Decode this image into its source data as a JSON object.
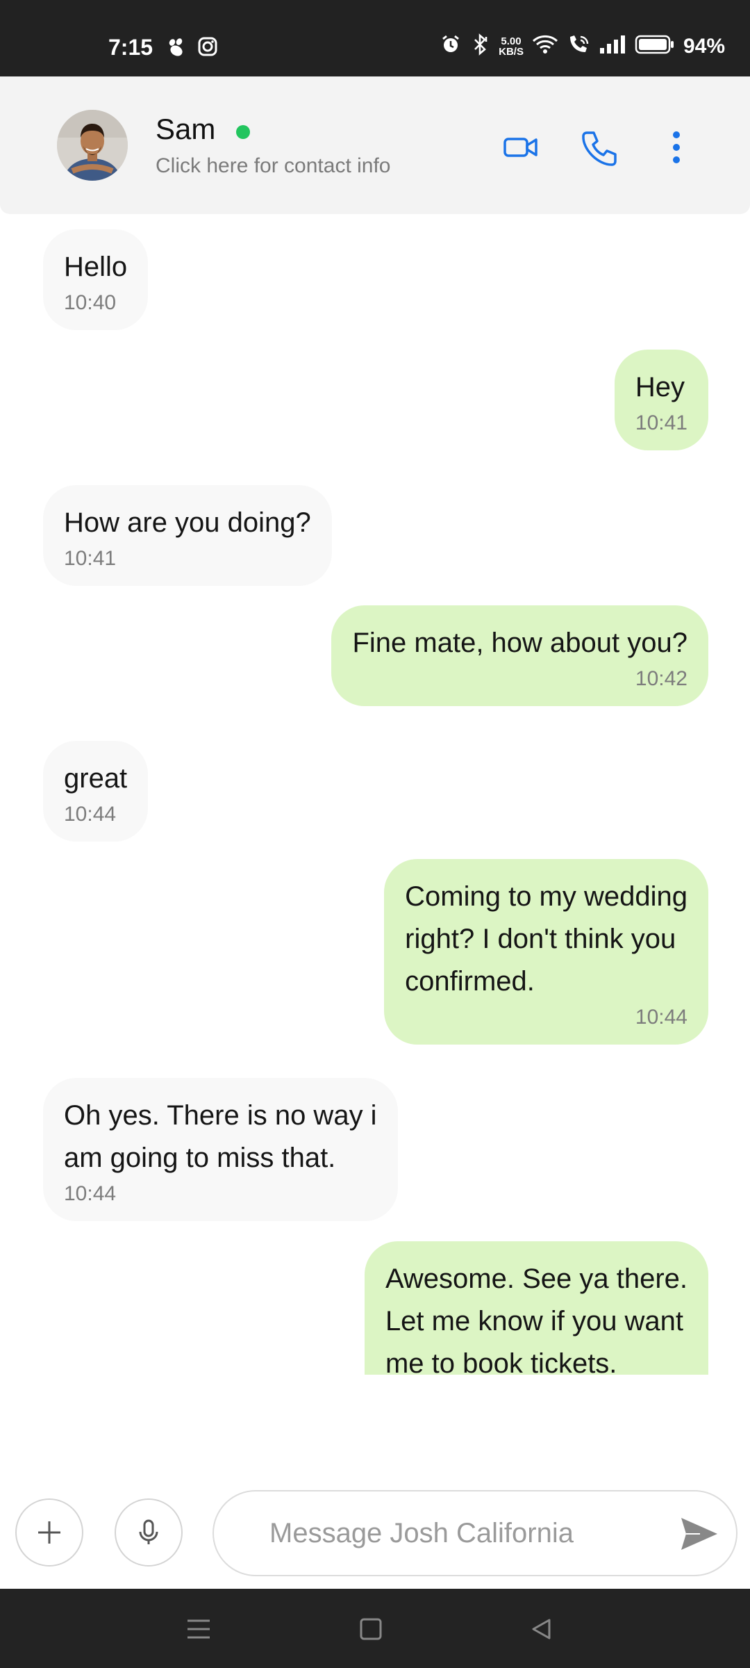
{
  "status_bar": {
    "time": "7:15",
    "speed_top": "5.00",
    "speed_bottom": "KB/S",
    "battery": "94%",
    "left_icons": [
      "paw-app-icon",
      "instagram-icon"
    ],
    "right_icons": [
      "alarm-icon",
      "bluetooth-icon",
      "wifi-icon",
      "wifi-call-icon",
      "signal-icon",
      "battery-icon"
    ]
  },
  "header": {
    "name": "Sam",
    "subtitle": "Click here for contact info",
    "online_color": "#22c55e",
    "accent_color": "#1a73e8"
  },
  "messages": [
    {
      "dir": "in",
      "lines": [
        "Hello"
      ],
      "time": "10:40"
    },
    {
      "dir": "out",
      "lines": [
        "Hey"
      ],
      "time": "10:41"
    },
    {
      "dir": "in",
      "lines": [
        "How are you doing?"
      ],
      "time": "10:41"
    },
    {
      "dir": "out",
      "lines": [
        "Fine mate, how about you?"
      ],
      "time": "10:42"
    },
    {
      "dir": "in",
      "lines": [
        "great"
      ],
      "time": "10:44"
    },
    {
      "dir": "out",
      "lines": [
        "Coming to my wedding",
        "right? I don't think you",
        "confirmed."
      ],
      "time": "10:44"
    },
    {
      "dir": "in",
      "lines": [
        "Oh yes. There is no way i",
        "am going to miss that."
      ],
      "time": "10:44"
    },
    {
      "dir": "out",
      "lines": [
        "Awesome. See ya there.",
        "Let me know if you want",
        "me to book tickets."
      ],
      "time": ""
    }
  ],
  "composer": {
    "placeholder": "Message Josh California",
    "value": ""
  }
}
